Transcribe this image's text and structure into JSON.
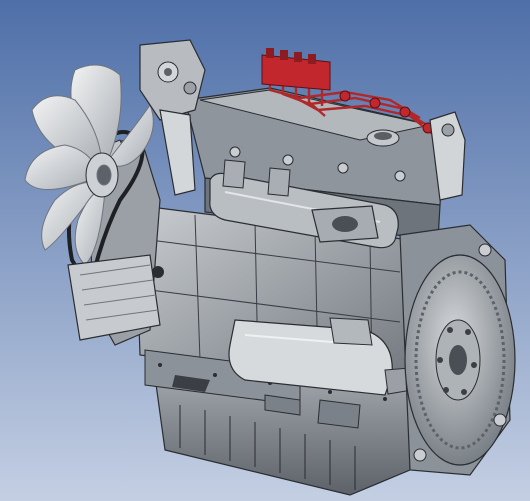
{
  "viewport": {
    "background_top": "#4e6fa8",
    "background_bottom": "#c4cfe3"
  },
  "model": {
    "subject": "engine-3d-render",
    "body_color": "#9aa0a6",
    "dark_color": "#4a4e55",
    "light_color": "#d9dcdf",
    "fuel_line_color": "#b0282a"
  }
}
